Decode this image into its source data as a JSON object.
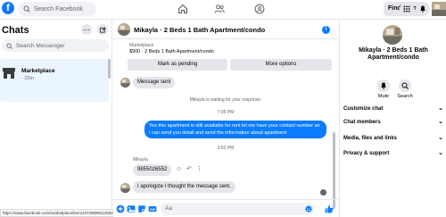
{
  "topbar": {
    "logo": "f",
    "search_placeholder": "Search Facebook",
    "find_friends_label": "Find friends"
  },
  "sidebar": {
    "title": "Chats",
    "search_placeholder": "Search Messenger",
    "items": [
      {
        "name": "Marketplace",
        "time": "· 22m"
      }
    ]
  },
  "conversation": {
    "title": "Mikayla · 2 Beds 1 Bath Apartment/condo",
    "marketplace_card": {
      "label": "Marketplace",
      "listing": "$900 · 2 Beds 1 Bath Apartment/condo",
      "mark_pending_label": "Mark as pending",
      "more_options_label": "More options"
    },
    "messages": {
      "sent_msg": "Message sent",
      "waiting_note": "Mikayla is waiting for your response.",
      "time_1": "7:05 PM",
      "outgoing_text": "Yes this apartment is still available for rent let me have your contact number so I can send you detail and send the information about apartment",
      "time_2": "9:50 PM",
      "sender_name": "Mikayla",
      "phone_msg": "9855026552",
      "apology_msg": "I apologize I thought the message sent."
    },
    "composer_placeholder": "Aa"
  },
  "details": {
    "name": "Mikayla · 2 Beds 1 Bath Apartment/condo",
    "mute_label": "Mute",
    "search_label": "Search",
    "rows": [
      "Customize chat",
      "Chat members",
      "Media, files and links",
      "Privacy & support"
    ]
  },
  "status_bar": {
    "url": "https://www.facebook.com/marketplace/item/1072959811285286/?referralSurfac..."
  },
  "colors": {
    "accent": "#0a7cff",
    "selected_chat": "#ebf5ff",
    "bubble_gray": "#e4e6eb"
  }
}
